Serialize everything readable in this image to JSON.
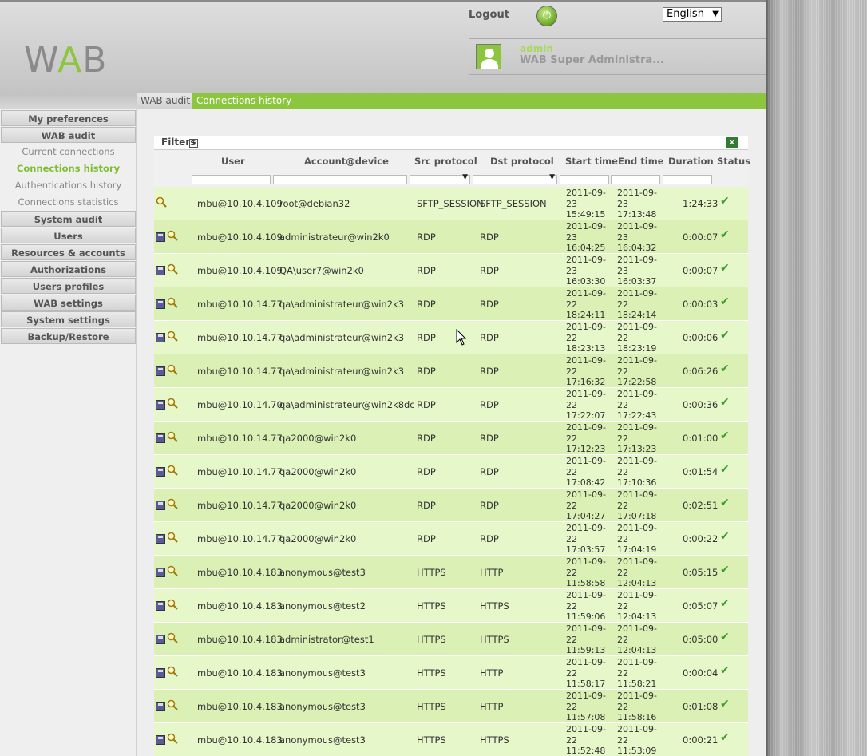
{
  "header": {
    "logo_left": "W",
    "logo_mid": "A",
    "logo_right": "B",
    "logout": "Logout",
    "language": "English",
    "user_name": "admin",
    "user_role": "WAB Super Administra..."
  },
  "breadcrumb": {
    "section": "WAB audit",
    "page": "Connections history"
  },
  "sidebar": {
    "items": [
      {
        "label": "My preferences",
        "type": "item"
      },
      {
        "label": "WAB audit",
        "type": "item"
      },
      {
        "label": "Current connections",
        "type": "sub"
      },
      {
        "label": "Connections history",
        "type": "sub-active"
      },
      {
        "label": "Authentications history",
        "type": "sub"
      },
      {
        "label": "Connections statistics",
        "type": "sub"
      },
      {
        "label": "System audit",
        "type": "item"
      },
      {
        "label": "Users",
        "type": "item"
      },
      {
        "label": "Resources & accounts",
        "type": "item"
      },
      {
        "label": "Authorizations",
        "type": "item"
      },
      {
        "label": "Users profiles",
        "type": "item"
      },
      {
        "label": "WAB settings",
        "type": "item"
      },
      {
        "label": "System settings",
        "type": "item"
      },
      {
        "label": "Backup/Restore",
        "type": "item"
      }
    ]
  },
  "filters": {
    "label": "Filters",
    "toggle": "+"
  },
  "table": {
    "columns": [
      "User",
      "Account@device",
      "Src protocol",
      "Dst protocol",
      "Start time",
      "End time",
      "Duration",
      "Status"
    ],
    "rows": [
      {
        "icons": "view",
        "user": "mbu@10.10.4.109",
        "account": "root@debian32",
        "src": "SFTP_SESSION",
        "dst": "SFTP_SESSION",
        "start": [
          "2011-09-",
          "23",
          "15:49:15"
        ],
        "end": [
          "2011-09-",
          "23",
          "17:13:48"
        ],
        "duration": "1:24:33"
      },
      {
        "icons": "both",
        "user": "mbu@10.10.4.109",
        "account": "administrateur@win2k0",
        "src": "RDP",
        "dst": "RDP",
        "start": [
          "2011-09-",
          "23",
          "16:04:25"
        ],
        "end": [
          "2011-09-",
          "23",
          "16:04:32"
        ],
        "duration": "0:00:07"
      },
      {
        "icons": "both",
        "user": "mbu@10.10.4.109",
        "account": "QA\\user7@win2k0",
        "src": "RDP",
        "dst": "RDP",
        "start": [
          "2011-09-",
          "23",
          "16:03:30"
        ],
        "end": [
          "2011-09-",
          "23",
          "16:03:37"
        ],
        "duration": "0:00:07"
      },
      {
        "icons": "both",
        "user": "mbu@10.10.14.77",
        "account": "qa\\administrateur@win2k3",
        "src": "RDP",
        "dst": "RDP",
        "start": [
          "2011-09-",
          "22",
          "18:24:11"
        ],
        "end": [
          "2011-09-",
          "22",
          "18:24:14"
        ],
        "duration": "0:00:03"
      },
      {
        "icons": "both",
        "user": "mbu@10.10.14.77",
        "account": "qa\\administrateur@win2k3",
        "src": "RDP",
        "dst": "RDP",
        "start": [
          "2011-09-",
          "22",
          "18:23:13"
        ],
        "end": [
          "2011-09-",
          "22",
          "18:23:19"
        ],
        "duration": "0:00:06"
      },
      {
        "icons": "both",
        "user": "mbu@10.10.14.77",
        "account": "qa\\administrateur@win2k3",
        "src": "RDP",
        "dst": "RDP",
        "start": [
          "2011-09-",
          "22",
          "17:16:32"
        ],
        "end": [
          "2011-09-",
          "22",
          "17:22:58"
        ],
        "duration": "0:06:26"
      },
      {
        "icons": "both",
        "user": "mbu@10.10.14.70",
        "account": "qa\\administrateur@win2k8dc",
        "src": "RDP",
        "dst": "RDP",
        "start": [
          "2011-09-",
          "22",
          "17:22:07"
        ],
        "end": [
          "2011-09-",
          "22",
          "17:22:43"
        ],
        "duration": "0:00:36"
      },
      {
        "icons": "both",
        "user": "mbu@10.10.14.77",
        "account": "qa2000@win2k0",
        "src": "RDP",
        "dst": "RDP",
        "start": [
          "2011-09-",
          "22",
          "17:12:23"
        ],
        "end": [
          "2011-09-",
          "22",
          "17:13:23"
        ],
        "duration": "0:01:00"
      },
      {
        "icons": "both",
        "user": "mbu@10.10.14.77",
        "account": "qa2000@win2k0",
        "src": "RDP",
        "dst": "RDP",
        "start": [
          "2011-09-",
          "22",
          "17:08:42"
        ],
        "end": [
          "2011-09-",
          "22",
          "17:10:36"
        ],
        "duration": "0:01:54"
      },
      {
        "icons": "both",
        "user": "mbu@10.10.14.77",
        "account": "qa2000@win2k0",
        "src": "RDP",
        "dst": "RDP",
        "start": [
          "2011-09-",
          "22",
          "17:04:27"
        ],
        "end": [
          "2011-09-",
          "22",
          "17:07:18"
        ],
        "duration": "0:02:51"
      },
      {
        "icons": "both",
        "user": "mbu@10.10.14.77",
        "account": "qa2000@win2k0",
        "src": "RDP",
        "dst": "RDP",
        "start": [
          "2011-09-",
          "22",
          "17:03:57"
        ],
        "end": [
          "2011-09-",
          "22",
          "17:04:19"
        ],
        "duration": "0:00:22"
      },
      {
        "icons": "both",
        "user": "mbu@10.10.4.183",
        "account": "anonymous@test3",
        "src": "HTTPS",
        "dst": "HTTP",
        "start": [
          "2011-09-",
          "22",
          "11:58:58"
        ],
        "end": [
          "2011-09-",
          "22",
          "12:04:13"
        ],
        "duration": "0:05:15"
      },
      {
        "icons": "both",
        "user": "mbu@10.10.4.183",
        "account": "anonymous@test2",
        "src": "HTTPS",
        "dst": "HTTPS",
        "start": [
          "2011-09-",
          "22",
          "11:59:06"
        ],
        "end": [
          "2011-09-",
          "22",
          "12:04:13"
        ],
        "duration": "0:05:07"
      },
      {
        "icons": "both",
        "user": "mbu@10.10.4.183",
        "account": "administrator@test1",
        "src": "HTTPS",
        "dst": "HTTPS",
        "start": [
          "2011-09-",
          "22",
          "11:59:13"
        ],
        "end": [
          "2011-09-",
          "22",
          "12:04:13"
        ],
        "duration": "0:05:00"
      },
      {
        "icons": "both",
        "user": "mbu@10.10.4.183",
        "account": "anonymous@test3",
        "src": "HTTPS",
        "dst": "HTTP",
        "start": [
          "2011-09-",
          "22",
          "11:58:17"
        ],
        "end": [
          "2011-09-",
          "22",
          "11:58:21"
        ],
        "duration": "0:00:04"
      },
      {
        "icons": "both",
        "user": "mbu@10.10.4.183",
        "account": "anonymous@test3",
        "src": "HTTPS",
        "dst": "HTTP",
        "start": [
          "2011-09-",
          "22",
          "11:57:08"
        ],
        "end": [
          "2011-09-",
          "22",
          "11:58:16"
        ],
        "duration": "0:01:08"
      },
      {
        "icons": "both",
        "user": "mbu@10.10.4.183",
        "account": "anonymous@test3",
        "src": "HTTPS",
        "dst": "HTTPS",
        "start": [
          "2011-09-",
          "22",
          "11:52:48"
        ],
        "end": [
          "2011-09-",
          "22",
          "11:53:09"
        ],
        "duration": "0:00:21"
      }
    ]
  },
  "icons": {
    "status": "check-icon",
    "save": "disk-icon",
    "view": "magnifier-icon",
    "export": "excel-icon",
    "logout": "power-icon"
  },
  "colors": {
    "accent": "#8cc63f",
    "row_odd": "#e6f7c9",
    "row_even": "#daf0b4"
  }
}
